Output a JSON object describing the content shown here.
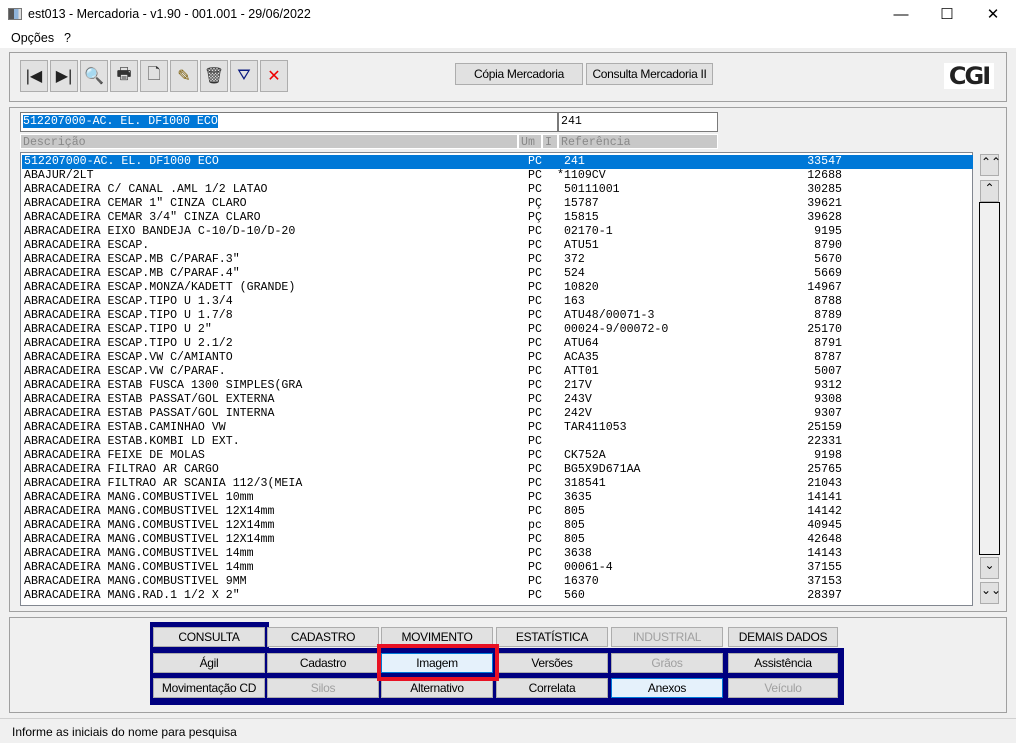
{
  "window": {
    "title": "est013 - Mercadoria - v1.90 - 001.001 - 29/06/2022",
    "minimize": "—",
    "maximize": "☐",
    "close": "✕"
  },
  "menu": [
    "Opções",
    "?"
  ],
  "toolbar": {
    "icons": [
      "first-record-icon",
      "last-record-icon",
      "search-icon",
      "print-icon",
      "new-document-icon",
      "edit-icon",
      "delete-icon",
      "filter-icon",
      "cancel-icon"
    ],
    "glyphs": [
      "|◀",
      "▶|",
      "🔍",
      "🖶",
      "🗋",
      "✎",
      "🗑",
      "⛛",
      "✕"
    ],
    "copy_label": "Cópia Mercadoria",
    "query_label": "Consulta Mercadoria II",
    "logo": "CGI"
  },
  "search": {
    "description_value": "512207000-AC. EL. DF1000 ECO",
    "reference_value": "241"
  },
  "columns": {
    "description": "Descrição",
    "unit": "Um",
    "i": "I",
    "reference": "Referência"
  },
  "rows": [
    [
      "512207000-AC. EL. DF1000 ECO",
      "PC",
      " 241",
      "33547"
    ],
    [
      "ABAJUR/2LT",
      "PC",
      "*1109CV",
      "12688"
    ],
    [
      "ABRACADEIRA C/ CANAL .AML 1/2 LATAO",
      "PC",
      " 50111001",
      "30285"
    ],
    [
      "ABRACADEIRA CEMAR 1\" CINZA CLARO",
      "PÇ",
      " 15787",
      "39621"
    ],
    [
      "ABRACADEIRA CEMAR 3/4\" CINZA CLARO",
      "PÇ",
      " 15815",
      "39628"
    ],
    [
      "ABRACADEIRA EIXO BANDEJA C-10/D-10/D-20",
      "PC",
      " 02170-1",
      "9195"
    ],
    [
      "ABRACADEIRA ESCAP.",
      "PC",
      " ATU51",
      "8790"
    ],
    [
      "ABRACADEIRA ESCAP.MB C/PARAF.3\"",
      "PC",
      " 372",
      "5670"
    ],
    [
      "ABRACADEIRA ESCAP.MB C/PARAF.4\"",
      "PC",
      " 524",
      "5669"
    ],
    [
      "ABRACADEIRA ESCAP.MONZA/KADETT (GRANDE)",
      "PC",
      " 10820",
      "14967"
    ],
    [
      "ABRACADEIRA ESCAP.TIPO U 1.3/4",
      "PC",
      " 163",
      "8788"
    ],
    [
      "ABRACADEIRA ESCAP.TIPO U 1.7/8",
      "PC",
      " ATU48/00071-3",
      "8789"
    ],
    [
      "ABRACADEIRA ESCAP.TIPO U 2\"",
      "PC",
      " 00024-9/00072-0",
      "25170"
    ],
    [
      "ABRACADEIRA ESCAP.TIPO U 2.1/2",
      "PC",
      " ATU64",
      "8791"
    ],
    [
      "ABRACADEIRA ESCAP.VW C/AMIANTO",
      "PC",
      " ACA35",
      "8787"
    ],
    [
      "ABRACADEIRA ESCAP.VW C/PARAF.",
      "PC",
      " ATT01",
      "5007"
    ],
    [
      "ABRACADEIRA ESTAB FUSCA 1300 SIMPLES(GRA",
      "PC",
      " 217V",
      "9312"
    ],
    [
      "ABRACADEIRA ESTAB PASSAT/GOL EXTERNA",
      "PC",
      " 243V",
      "9308"
    ],
    [
      "ABRACADEIRA ESTAB PASSAT/GOL INTERNA",
      "PC",
      " 242V",
      "9307"
    ],
    [
      "ABRACADEIRA ESTAB.CAMINHAO VW",
      "PC",
      " TAR411053",
      "25159"
    ],
    [
      "ABRACADEIRA ESTAB.KOMBI LD EXT.",
      "PC",
      "",
      "22331"
    ],
    [
      "ABRACADEIRA FEIXE DE MOLAS",
      "PC",
      " CK752A",
      "9198"
    ],
    [
      "ABRACADEIRA FILTRAO AR CARGO",
      "PC",
      " BG5X9D671AA",
      "25765"
    ],
    [
      "ABRACADEIRA FILTRAO AR SCANIA 112/3(MEIA",
      "PC",
      " 318541",
      "21043"
    ],
    [
      "ABRACADEIRA MANG.COMBUSTIVEL 10mm",
      "PC",
      " 3635",
      "14141"
    ],
    [
      "ABRACADEIRA MANG.COMBUSTIVEL 12X14mm",
      "PC",
      " 805",
      "14142"
    ],
    [
      "ABRACADEIRA MANG.COMBUSTIVEL 12X14mm",
      "pc",
      " 805",
      "40945"
    ],
    [
      "ABRACADEIRA MANG.COMBUSTIVEL 12X14mm",
      "PC",
      " 805",
      "42648"
    ],
    [
      "ABRACADEIRA MANG.COMBUSTIVEL 14mm",
      "PC",
      " 3638",
      "14143"
    ],
    [
      "ABRACADEIRA MANG.COMBUSTIVEL 14mm",
      "PC",
      " 00061-4",
      "37155"
    ],
    [
      "ABRACADEIRA MANG.COMBUSTIVEL 9MM",
      "PC",
      " 16370",
      "37153"
    ],
    [
      "ABRACADEIRA MANG.RAD.1 1/2 X 2\"",
      "PC",
      " 560",
      "28397"
    ]
  ],
  "scroll": {
    "top": "⌃⌃",
    "up": "⌃",
    "down": "⌄",
    "bottom": "⌄⌄"
  },
  "tabs": [
    {
      "label": "CONSULTA",
      "enabled": true
    },
    {
      "label": "CADASTRO",
      "enabled": true
    },
    {
      "label": "MOVIMENTO",
      "enabled": true
    },
    {
      "label": "ESTATÍSTICA",
      "enabled": true
    },
    {
      "label": "INDUSTRIAL",
      "enabled": false
    },
    {
      "label": "DEMAIS DADOS",
      "enabled": true
    }
  ],
  "actions_row1": [
    {
      "label": "Ágil",
      "enabled": true
    },
    {
      "label": "Cadastro",
      "enabled": true
    },
    {
      "label": "Imagem",
      "enabled": true,
      "highlighted": true
    },
    {
      "label": "Versões",
      "enabled": true
    },
    {
      "label": "Grãos",
      "enabled": false
    },
    {
      "label": "Assistência",
      "enabled": true
    }
  ],
  "actions_row2": [
    {
      "label": "Movimentação CD",
      "enabled": true
    },
    {
      "label": "Silos",
      "enabled": false
    },
    {
      "label": "Alternativo",
      "enabled": true
    },
    {
      "label": "Correlata",
      "enabled": true
    },
    {
      "label": "Anexos",
      "enabled": true,
      "active": true
    },
    {
      "label": "Veículo",
      "enabled": false
    }
  ],
  "status": "Informe as iniciais do nome para pesquisa",
  "colors": {
    "selection": "#0078d7",
    "frame": "#000080",
    "highlight_box": "#e81123"
  }
}
